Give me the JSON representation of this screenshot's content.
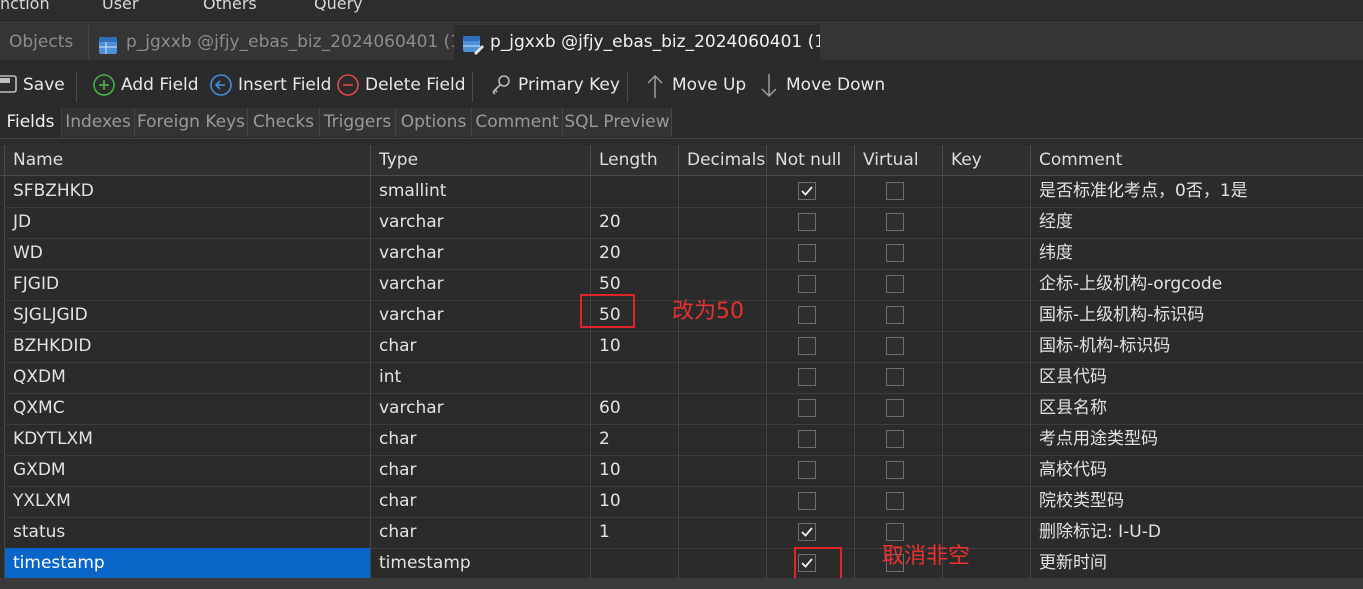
{
  "menu": [
    "nction",
    "User",
    "Others",
    "Query"
  ],
  "tabs": [
    {
      "label": "Objects",
      "active": false
    },
    {
      "label": "p_jgxxb @jfjy_ebas_biz_2024060401 (1...",
      "active": false
    },
    {
      "label": "p_jgxxb @jfjy_ebas_biz_2024060401 (1...",
      "active": true
    }
  ],
  "toolbar": {
    "save": "Save",
    "add_field": "Add Field",
    "insert_field": "Insert Field",
    "delete_field": "Delete Field",
    "primary_key": "Primary Key",
    "move_up": "Move Up",
    "move_down": "Move Down"
  },
  "subtabs": [
    "Fields",
    "Indexes",
    "Foreign Keys",
    "Checks",
    "Triggers",
    "Options",
    "Comment",
    "SQL Preview"
  ],
  "columns": [
    "Name",
    "Type",
    "Length",
    "Decimals",
    "Not null",
    "Virtual",
    "Key",
    "Comment"
  ],
  "rows": [
    {
      "name": "SFBZHKD",
      "type": "smallint",
      "length": "",
      "decimals": "",
      "not_null": true,
      "virtual": false,
      "key": "",
      "comment": "是否标准化考点，0否，1是"
    },
    {
      "name": "JD",
      "type": "varchar",
      "length": "20",
      "decimals": "",
      "not_null": false,
      "virtual": false,
      "key": "",
      "comment": "经度"
    },
    {
      "name": "WD",
      "type": "varchar",
      "length": "20",
      "decimals": "",
      "not_null": false,
      "virtual": false,
      "key": "",
      "comment": "纬度"
    },
    {
      "name": "FJGID",
      "type": "varchar",
      "length": "50",
      "decimals": "",
      "not_null": false,
      "virtual": false,
      "key": "",
      "comment": "企标-上级机构-orgcode"
    },
    {
      "name": "SJGLJGID",
      "type": "varchar",
      "length": "50",
      "decimals": "",
      "not_null": false,
      "virtual": false,
      "key": "",
      "comment": "国标-上级机构-标识码"
    },
    {
      "name": "BZHKDID",
      "type": "char",
      "length": "10",
      "decimals": "",
      "not_null": false,
      "virtual": false,
      "key": "",
      "comment": "国标-机构-标识码"
    },
    {
      "name": "QXDM",
      "type": "int",
      "length": "",
      "decimals": "",
      "not_null": false,
      "virtual": false,
      "key": "",
      "comment": "区县代码"
    },
    {
      "name": "QXMC",
      "type": "varchar",
      "length": "60",
      "decimals": "",
      "not_null": false,
      "virtual": false,
      "key": "",
      "comment": "区县名称"
    },
    {
      "name": "KDYTLXM",
      "type": "char",
      "length": "2",
      "decimals": "",
      "not_null": false,
      "virtual": false,
      "key": "",
      "comment": "考点用途类型码"
    },
    {
      "name": "GXDM",
      "type": "char",
      "length": "10",
      "decimals": "",
      "not_null": false,
      "virtual": false,
      "key": "",
      "comment": "高校代码"
    },
    {
      "name": "YXLXM",
      "type": "char",
      "length": "10",
      "decimals": "",
      "not_null": false,
      "virtual": false,
      "key": "",
      "comment": "院校类型码"
    },
    {
      "name": "status",
      "type": "char",
      "length": "1",
      "decimals": "",
      "not_null": true,
      "virtual": false,
      "key": "",
      "comment": "删除标记: I-U-D"
    },
    {
      "name": "timestamp",
      "type": "timestamp",
      "length": "",
      "decimals": "",
      "not_null": true,
      "virtual": false,
      "key": "",
      "comment": "更新时间",
      "selected": true
    }
  ],
  "annotations": [
    {
      "text": "改为50",
      "row": 4,
      "column": "length"
    },
    {
      "text": "取消非空",
      "row": 12,
      "column": "not_null"
    }
  ],
  "colors": {
    "accent": "#0a65c8",
    "annotation": "#e0242a",
    "background": "#2b2b2b"
  }
}
